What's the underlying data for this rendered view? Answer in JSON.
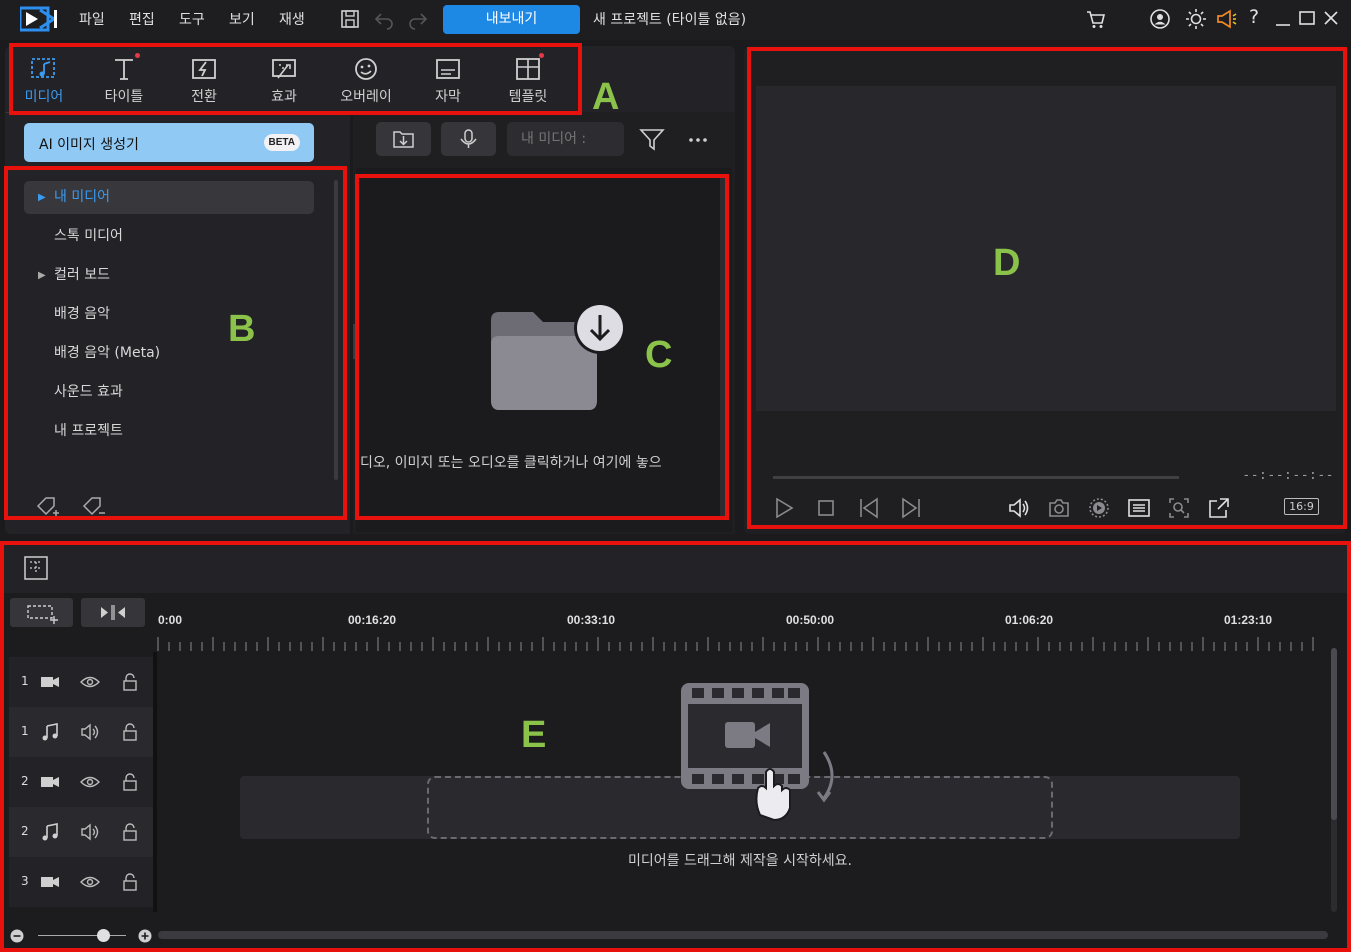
{
  "menu": [
    "파일",
    "편집",
    "도구",
    "보기",
    "재생"
  ],
  "export_label": "내보내기",
  "project_title": "새 프로젝트 (타이틀 없음)",
  "tabs": [
    {
      "label": "미디어",
      "icon": "media-icon",
      "active": true
    },
    {
      "label": "타이틀",
      "icon": "title-icon",
      "badge": true
    },
    {
      "label": "전환",
      "icon": "transition-icon"
    },
    {
      "label": "효과",
      "icon": "effect-icon"
    },
    {
      "label": "오버레이",
      "icon": "overlay-icon"
    },
    {
      "label": "자막",
      "icon": "subtitle-icon"
    },
    {
      "label": "템플릿",
      "icon": "template-icon",
      "badge": true
    }
  ],
  "library": {
    "ai_button": "AI 이미지 생성기",
    "beta": "BETA",
    "items": [
      {
        "label": "내 미디어",
        "expandable": true,
        "selected": true
      },
      {
        "label": "스톡 미디어"
      },
      {
        "label": "컬러 보드",
        "expandable": true
      },
      {
        "label": "배경 음악"
      },
      {
        "label": "배경 음악 (Meta)"
      },
      {
        "label": "사운드 효과"
      },
      {
        "label": "내 프로젝트"
      }
    ]
  },
  "media": {
    "search_placeholder": "내 미디어 :",
    "empty_hint": "디오, 이미지 또는 오디오를 클릭하거나 여기에 놓으"
  },
  "preview": {
    "timecode": "--:--:--:--",
    "aspect_ratio": "16:9"
  },
  "timeline": {
    "ruler": [
      "0:00",
      "00:16:20",
      "00:33:10",
      "00:50:00",
      "01:06:20",
      "01:23:10"
    ],
    "tracks": [
      {
        "number": "1",
        "type": "video"
      },
      {
        "number": "1",
        "type": "audio"
      },
      {
        "number": "2",
        "type": "video"
      },
      {
        "number": "2",
        "type": "audio"
      },
      {
        "number": "3",
        "type": "video"
      }
    ],
    "drop_hint": "미디어를 드래그해 제작을 시작하세요."
  },
  "region_labels": [
    "A",
    "B",
    "C",
    "D",
    "E"
  ],
  "colors": {
    "accent": "#1e88e5",
    "highlight": "#e8110b",
    "letters": "#8bc34a"
  }
}
